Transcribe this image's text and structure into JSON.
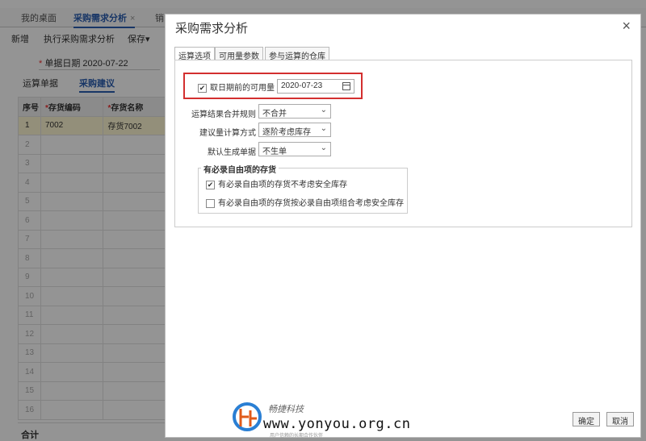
{
  "app": {
    "tabs": [
      {
        "label": "我的桌面"
      },
      {
        "label": "采购需求分析",
        "close": "×"
      },
      {
        "label": "销"
      }
    ],
    "toolbar": {
      "new": "新增",
      "run": "执行采购需求分析",
      "save": "保存",
      "save_caret": "▾"
    },
    "doc_date_label": "单据日期",
    "doc_date_value": "2020-07-22",
    "subtabs": [
      "运算单据",
      "采购建议"
    ],
    "grid": {
      "headers": [
        "序号",
        "存货编码",
        "存货名称"
      ],
      "rows": [
        [
          "1",
          "7002",
          "存货7002"
        ],
        [
          "2",
          "",
          ""
        ],
        [
          "3",
          "",
          ""
        ],
        [
          "4",
          "",
          ""
        ],
        [
          "5",
          "",
          ""
        ],
        [
          "6",
          "",
          ""
        ],
        [
          "7",
          "",
          ""
        ],
        [
          "8",
          "",
          ""
        ],
        [
          "9",
          "",
          ""
        ],
        [
          "10",
          "",
          ""
        ],
        [
          "11",
          "",
          ""
        ],
        [
          "12",
          "",
          ""
        ],
        [
          "13",
          "",
          ""
        ],
        [
          "14",
          "",
          ""
        ],
        [
          "15",
          "",
          ""
        ],
        [
          "16",
          "",
          ""
        ]
      ]
    },
    "footer_label": "合计"
  },
  "dialog": {
    "title": "采购需求分析",
    "close": "×",
    "tabs": [
      "运算选项",
      "可用量参数",
      "参与运算的仓库"
    ],
    "available_before_date": {
      "checked": true,
      "label": "取日期前的可用量",
      "date": "2020-07-23"
    },
    "fields": [
      {
        "label": "运算结果合并规则",
        "value": "不合并"
      },
      {
        "label": "建议量计算方式",
        "value": "逐阶考虑库存"
      },
      {
        "label": "默认生成单据",
        "value": "不生单"
      }
    ],
    "free_items": {
      "legend": "有必录自由项的存货",
      "options": [
        {
          "checked": true,
          "label": "有必录自由项的存货不考虑安全库存"
        },
        {
          "checked": false,
          "label": "有必录自由项的存货按必录自由项组合考虑安全库存"
        }
      ]
    },
    "ok_label": "确定",
    "cancel_label": "取消"
  },
  "watermark": {
    "cn": "畅捷科技",
    "url": "www.yonyou.org.cn",
    "sub": "用户信赖的长期合作伙伴"
  },
  "colors": {
    "accent": "#2a5db0",
    "highlight": "#d32f2f",
    "selected_row": "#fdf6d2",
    "required": "#e33333"
  }
}
